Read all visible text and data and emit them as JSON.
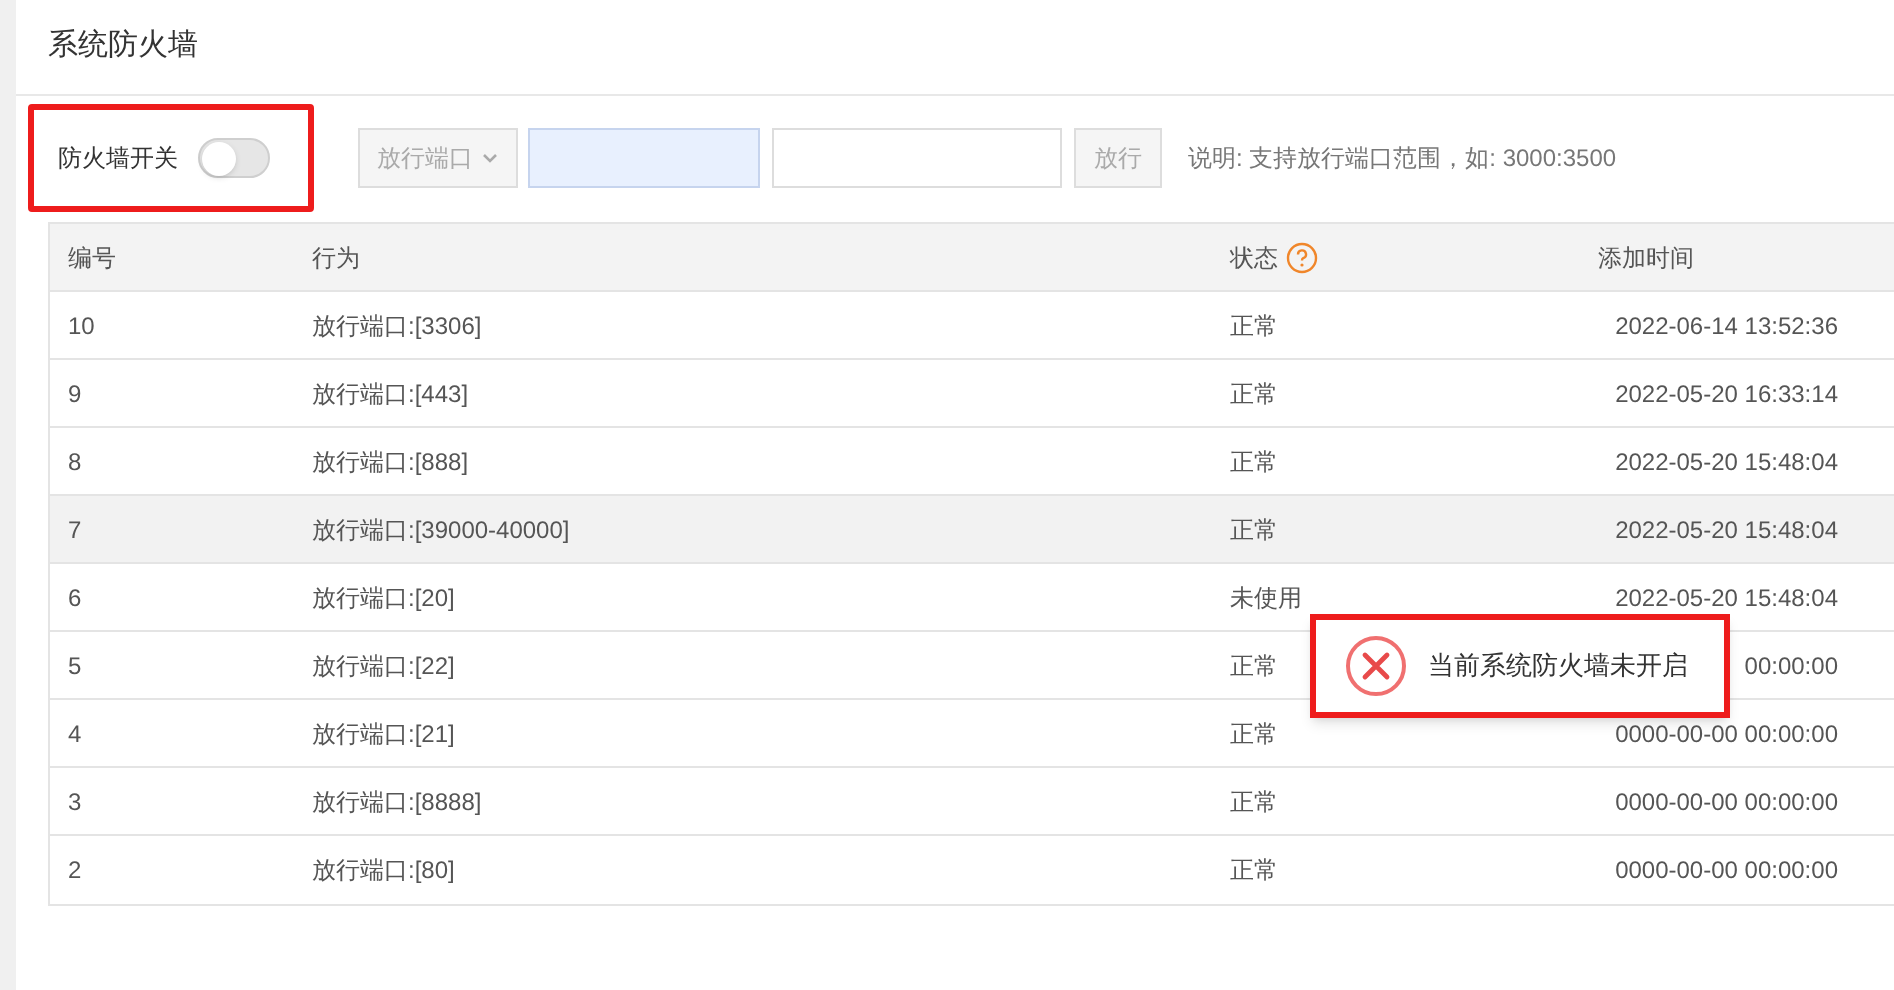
{
  "panel": {
    "title": "系统防火墙"
  },
  "toolbar": {
    "switch_label": "防火墙开关",
    "switch_on": false,
    "protocol_select": {
      "value": "放行端口",
      "disabled": true
    },
    "submit_button": {
      "label": "放行",
      "disabled": true
    },
    "hint": "说明: 支持放行端口范围，如: 3000:3500"
  },
  "table": {
    "columns": [
      "编号",
      "行为",
      "状态",
      "添加时间"
    ],
    "rows": [
      {
        "id": "10",
        "action": "放行端口:[3306]",
        "status": "正常",
        "time": "2022-06-14 13:52:36",
        "highlighted": false
      },
      {
        "id": "9",
        "action": "放行端口:[443]",
        "status": "正常",
        "time": "2022-05-20 16:33:14",
        "highlighted": false
      },
      {
        "id": "8",
        "action": "放行端口:[888]",
        "status": "正常",
        "time": "2022-05-20 15:48:04",
        "highlighted": false
      },
      {
        "id": "7",
        "action": "放行端口:[39000-40000]",
        "status": "正常",
        "time": "2022-05-20 15:48:04",
        "highlighted": true
      },
      {
        "id": "6",
        "action": "放行端口:[20]",
        "status": "未使用",
        "time": "2022-05-20 15:48:04",
        "highlighted": false
      },
      {
        "id": "5",
        "action": "放行端口:[22]",
        "status": "正常",
        "time": "00:00:00",
        "highlighted": false
      },
      {
        "id": "4",
        "action": "放行端口:[21]",
        "status": "正常",
        "time": "0000-00-00 00:00:00",
        "highlighted": false
      },
      {
        "id": "3",
        "action": "放行端口:[8888]",
        "status": "正常",
        "time": "0000-00-00 00:00:00",
        "highlighted": false
      },
      {
        "id": "2",
        "action": "放行端口:[80]",
        "status": "正常",
        "time": "0000-00-00 00:00:00",
        "highlighted": false
      }
    ]
  },
  "toast": {
    "message": "当前系统防火墙未开启"
  }
}
